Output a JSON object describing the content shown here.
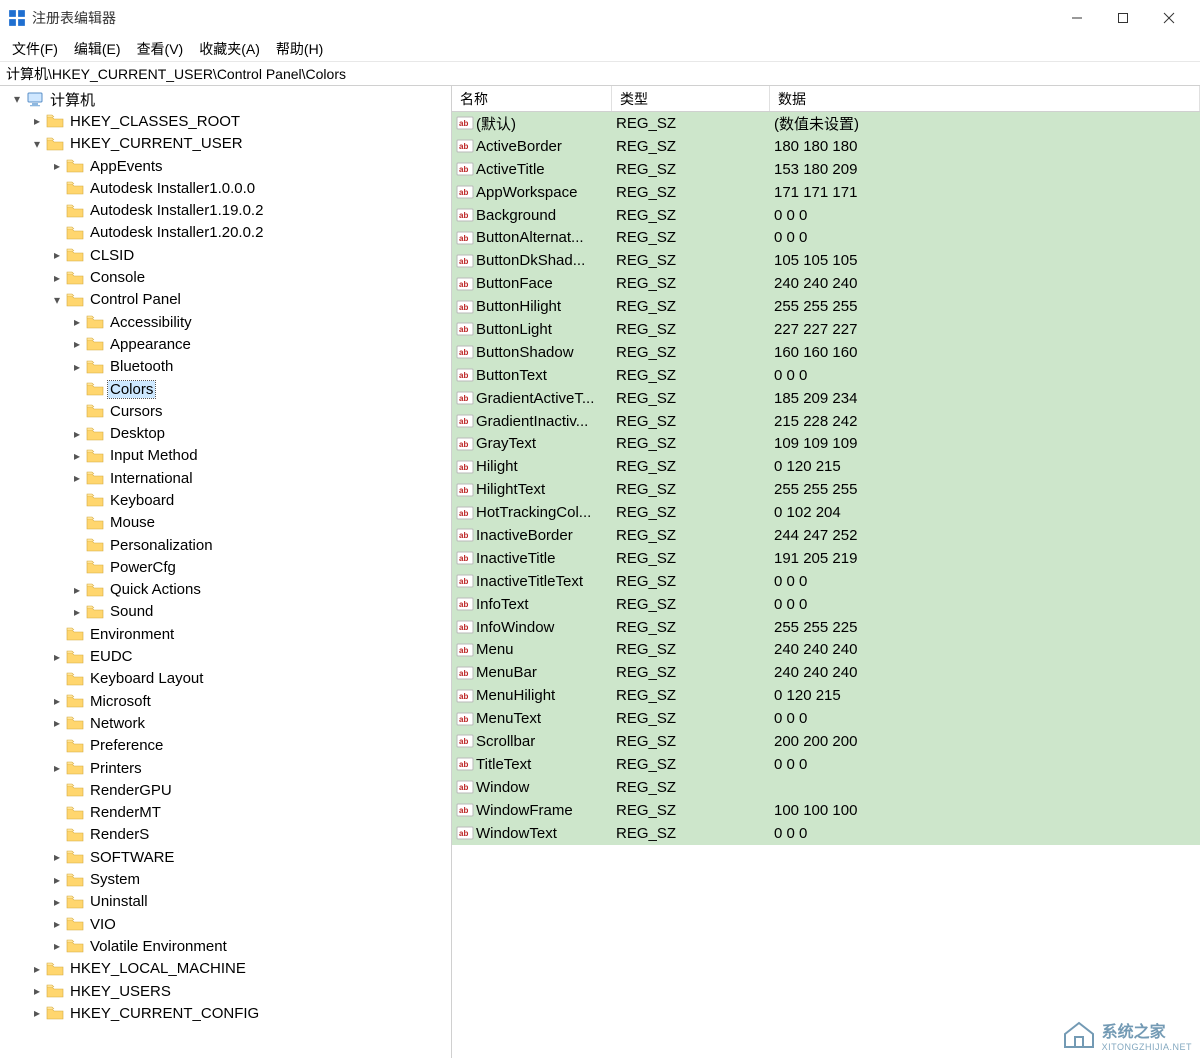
{
  "window": {
    "title": "注册表编辑器"
  },
  "menu": {
    "file": "文件(F)",
    "edit": "编辑(E)",
    "view": "查看(V)",
    "favorites": "收藏夹(A)",
    "help": "帮助(H)"
  },
  "address": "计算机\\HKEY_CURRENT_USER\\Control Panel\\Colors",
  "tree": {
    "root": "计算机",
    "hives": {
      "hkcr": "HKEY_CLASSES_ROOT",
      "hkcu": "HKEY_CURRENT_USER",
      "hklm": "HKEY_LOCAL_MACHINE",
      "hku": "HKEY_USERS",
      "hkcc": "HKEY_CURRENT_CONFIG"
    },
    "hkcu_children": [
      {
        "name": "AppEvents",
        "hasChildren": true
      },
      {
        "name": "Autodesk Installer1.0.0.0",
        "hasChildren": false
      },
      {
        "name": "Autodesk Installer1.19.0.2",
        "hasChildren": false
      },
      {
        "name": "Autodesk Installer1.20.0.2",
        "hasChildren": false
      },
      {
        "name": "CLSID",
        "hasChildren": true
      },
      {
        "name": "Console",
        "hasChildren": true
      },
      {
        "name": "Control Panel",
        "hasChildren": true,
        "expanded": true
      },
      {
        "name": "Environment",
        "hasChildren": false
      },
      {
        "name": "EUDC",
        "hasChildren": true
      },
      {
        "name": "Keyboard Layout",
        "hasChildren": false
      },
      {
        "name": "Microsoft",
        "hasChildren": true
      },
      {
        "name": "Network",
        "hasChildren": true
      },
      {
        "name": "Preference",
        "hasChildren": false
      },
      {
        "name": "Printers",
        "hasChildren": true
      },
      {
        "name": "RenderGPU",
        "hasChildren": false
      },
      {
        "name": "RenderMT",
        "hasChildren": false
      },
      {
        "name": "RenderS",
        "hasChildren": false
      },
      {
        "name": "SOFTWARE",
        "hasChildren": true
      },
      {
        "name": "System",
        "hasChildren": true
      },
      {
        "name": "Uninstall",
        "hasChildren": true
      },
      {
        "name": "VIO",
        "hasChildren": true
      },
      {
        "name": "Volatile Environment",
        "hasChildren": true
      }
    ],
    "control_panel_children": [
      {
        "name": "Accessibility",
        "hasChildren": true
      },
      {
        "name": "Appearance",
        "hasChildren": true
      },
      {
        "name": "Bluetooth",
        "hasChildren": true
      },
      {
        "name": "Colors",
        "hasChildren": false,
        "selected": true
      },
      {
        "name": "Cursors",
        "hasChildren": false
      },
      {
        "name": "Desktop",
        "hasChildren": true
      },
      {
        "name": "Input Method",
        "hasChildren": true
      },
      {
        "name": "International",
        "hasChildren": true
      },
      {
        "name": "Keyboard",
        "hasChildren": false
      },
      {
        "name": "Mouse",
        "hasChildren": false
      },
      {
        "name": "Personalization",
        "hasChildren": false
      },
      {
        "name": "PowerCfg",
        "hasChildren": false
      },
      {
        "name": "Quick Actions",
        "hasChildren": true
      },
      {
        "name": "Sound",
        "hasChildren": true
      }
    ]
  },
  "columns": {
    "name": "名称",
    "type": "类型",
    "data": "数据"
  },
  "values": [
    {
      "name": "(默认)",
      "type": "REG_SZ",
      "data": "(数值未设置)"
    },
    {
      "name": "ActiveBorder",
      "type": "REG_SZ",
      "data": "180 180 180"
    },
    {
      "name": "ActiveTitle",
      "type": "REG_SZ",
      "data": "153 180 209"
    },
    {
      "name": "AppWorkspace",
      "type": "REG_SZ",
      "data": "171 171 171"
    },
    {
      "name": "Background",
      "type": "REG_SZ",
      "data": "0 0 0"
    },
    {
      "name": "ButtonAlternat...",
      "type": "REG_SZ",
      "data": "0 0 0"
    },
    {
      "name": "ButtonDkShad...",
      "type": "REG_SZ",
      "data": "105 105 105"
    },
    {
      "name": "ButtonFace",
      "type": "REG_SZ",
      "data": "240 240 240"
    },
    {
      "name": "ButtonHilight",
      "type": "REG_SZ",
      "data": "255 255 255"
    },
    {
      "name": "ButtonLight",
      "type": "REG_SZ",
      "data": "227 227 227"
    },
    {
      "name": "ButtonShadow",
      "type": "REG_SZ",
      "data": "160 160 160"
    },
    {
      "name": "ButtonText",
      "type": "REG_SZ",
      "data": "0 0 0"
    },
    {
      "name": "GradientActiveT...",
      "type": "REG_SZ",
      "data": "185 209 234"
    },
    {
      "name": "GradientInactiv...",
      "type": "REG_SZ",
      "data": "215 228 242"
    },
    {
      "name": "GrayText",
      "type": "REG_SZ",
      "data": "109 109 109"
    },
    {
      "name": "Hilight",
      "type": "REG_SZ",
      "data": "0 120 215"
    },
    {
      "name": "HilightText",
      "type": "REG_SZ",
      "data": "255 255 255"
    },
    {
      "name": "HotTrackingCol...",
      "type": "REG_SZ",
      "data": "0 102 204"
    },
    {
      "name": "InactiveBorder",
      "type": "REG_SZ",
      "data": "244 247 252"
    },
    {
      "name": "InactiveTitle",
      "type": "REG_SZ",
      "data": "191 205 219"
    },
    {
      "name": "InactiveTitleText",
      "type": "REG_SZ",
      "data": "0 0 0"
    },
    {
      "name": "InfoText",
      "type": "REG_SZ",
      "data": "0 0 0"
    },
    {
      "name": "InfoWindow",
      "type": "REG_SZ",
      "data": "255 255 225"
    },
    {
      "name": "Menu",
      "type": "REG_SZ",
      "data": "240 240 240"
    },
    {
      "name": "MenuBar",
      "type": "REG_SZ",
      "data": "240 240 240"
    },
    {
      "name": "MenuHilight",
      "type": "REG_SZ",
      "data": "0 120 215"
    },
    {
      "name": "MenuText",
      "type": "REG_SZ",
      "data": "0 0 0"
    },
    {
      "name": "Scrollbar",
      "type": "REG_SZ",
      "data": "200 200 200"
    },
    {
      "name": "TitleText",
      "type": "REG_SZ",
      "data": "0 0 0"
    },
    {
      "name": "Window",
      "type": "REG_SZ",
      "data": ""
    },
    {
      "name": "WindowFrame",
      "type": "REG_SZ",
      "data": "100 100 100"
    },
    {
      "name": "WindowText",
      "type": "REG_SZ",
      "data": "0 0 0"
    }
  ],
  "watermark": {
    "title": "系统之家",
    "sub": "XITONGZHIJIA.NET"
  }
}
